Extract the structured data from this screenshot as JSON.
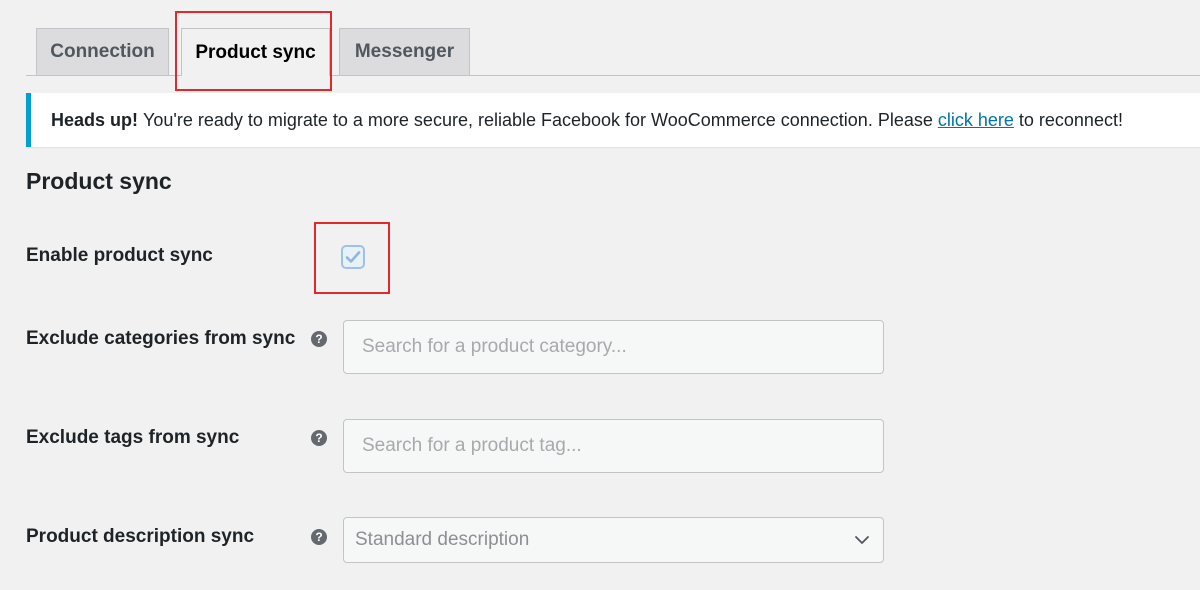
{
  "tabs": [
    {
      "label": "Connection",
      "active": false
    },
    {
      "label": "Product sync",
      "active": true
    },
    {
      "label": "Messenger",
      "active": false
    }
  ],
  "notice": {
    "strong": "Heads up!",
    "text": "You're ready to migrate to a more secure, reliable Facebook for WooCommerce connection. Please",
    "link": "click here",
    "suffix": "to reconnect!"
  },
  "section": {
    "title": "Product sync"
  },
  "fields": {
    "enable_sync": {
      "label": "Enable product sync",
      "checked": true
    },
    "exclude_categories": {
      "label": "Exclude categories from sync",
      "placeholder": "Search for a product category..."
    },
    "exclude_tags": {
      "label": "Exclude tags from sync",
      "placeholder": "Search for a product tag..."
    },
    "description_sync": {
      "label": "Product description sync",
      "value": "Standard description"
    }
  },
  "help_icon": "question-mark-icon",
  "colors": {
    "accent": "#00a0d2",
    "link": "#0073aa",
    "highlight": "#e0282d"
  }
}
